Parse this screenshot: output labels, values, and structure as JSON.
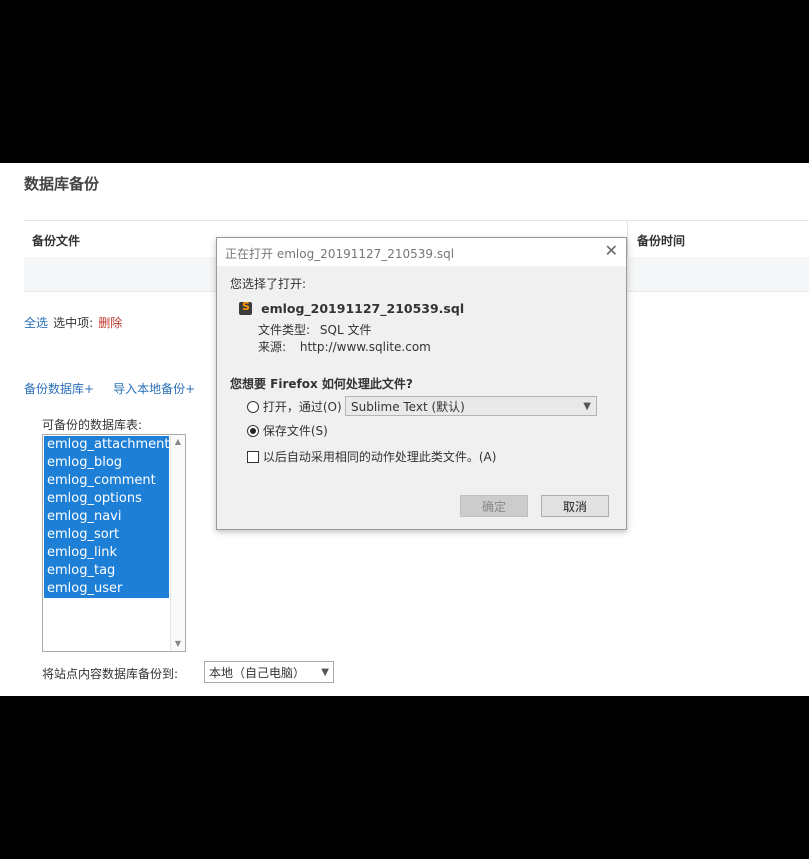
{
  "page": {
    "title": "数据库备份",
    "table": {
      "col_file": "备份文件",
      "col_time": "备份时间"
    },
    "select_all": "全选",
    "selected_label": "选中项:",
    "delete_label": "删除",
    "backup_db_link": "备份数据库+",
    "import_local_link": "导入本地备份+",
    "tables_label": "可备份的数据库表:",
    "tables": [
      "emlog_attachment",
      "emlog_blog",
      "emlog_comment",
      "emlog_options",
      "emlog_navi",
      "emlog_sort",
      "emlog_link",
      "emlog_tag",
      "emlog_user"
    ],
    "backup_to_label": "将站点内容数据库备份到:",
    "backup_to_value": "本地（自己电脑）"
  },
  "dialog": {
    "title": "正在打开 emlog_20191127_210539.sql",
    "chosen_label": "您选择了打开:",
    "filename": "emlog_20191127_210539.sql",
    "filetype_label": "文件类型:",
    "filetype_value": "SQL 文件",
    "source_label": "来源:",
    "source_value": "http://www.sqlite.com",
    "question": "您想要 Firefox 如何处理此文件?",
    "open_with_label": "打开，通过(O)",
    "open_with_app": "Sublime Text (默认)",
    "save_file_label": "保存文件(S)",
    "auto_label": "以后自动采用相同的动作处理此类文件。(A)",
    "ok_label": "确定",
    "cancel_label": "取消",
    "open_selected": false,
    "save_selected": true,
    "auto_checked": false
  },
  "colors": {
    "link": "#2a6fb8",
    "delete": "#c0392b",
    "selection": "#1e7fd6",
    "sublime_icon": "#ff9800"
  },
  "icons": {
    "file_icon": "sublime-text-icon",
    "close": "close-icon",
    "dropdown": "chevron-down-icon"
  }
}
